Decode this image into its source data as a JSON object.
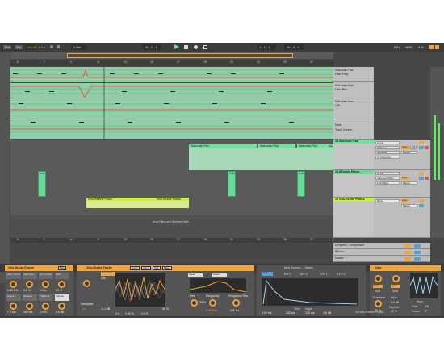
{
  "transport": {
    "link": "Link",
    "tap": "Tap",
    "tempo": "120.00",
    "signature": "4 / 4",
    "quantize": "1 Bar",
    "position": "13 . 1 . 1",
    "loop_start": "1 . 1 . 1",
    "loop_length": "16 . 0 . 0",
    "key": "KEY",
    "midi": "MIDI",
    "cpu": "6 %"
  },
  "tracks": [
    {
      "name": "Sidechain Pad",
      "sub": "Filter Freq"
    },
    {
      "name": "Sidechain Pad",
      "sub": "Filter Res"
    },
    {
      "name": "Sidechain Pad",
      "sub": "1 Rt"
    },
    {
      "name": "Mixer",
      "sub": "Track Volume"
    },
    {
      "name": "14 Sidechain Pad",
      "input": "All Ins",
      "routing": "3-Stimps",
      "monitor": "Sidechain",
      "channel": "All Channels",
      "mon_auto": "Auto",
      "mon_off": "Off",
      "master": "Master"
    },
    {
      "name": "15 A Humid Pillow",
      "input": "All Ins",
      "routing": "A-Humid Pillow",
      "monitor": "Filter Bass",
      "channel": "All Channels",
      "mon_auto": "Auto",
      "master": "Master"
    },
    {
      "name": "16 Velo-Resize Plucks",
      "input": "None",
      "monitor": "Auto",
      "master": "Master"
    }
  ],
  "clips": {
    "sidechain_a": "Sidechain Pad",
    "sidechain_b": "Sidechain Pad",
    "sidechain_c": "Sidechain Pad",
    "sidechain_d": "Sidechain",
    "humid": "A Hu",
    "plucks_a": "Velo-Resize Plucks",
    "plucks_b": "Velo-Resize Plucks"
  },
  "drop_hint": "Drop Files and Devices Here",
  "returns": [
    {
      "name": "A Reverb | Compressor"
    },
    {
      "name": "B Echo"
    },
    {
      "name": "Master"
    }
  ],
  "devices": {
    "rack_title": "Velo-Resize Plucks",
    "rack_buttons": [
      "Filter Cutoff",
      "Filter Res",
      "Osc 2 Pitch",
      "Echo",
      "Attack",
      "Release",
      "Transient",
      "Volume"
    ],
    "rack_values": [
      "5.88 kHz",
      "0.0 %",
      "0.0 st",
      "21 %",
      "7.5 ms",
      "180 ms",
      "0.0 %",
      "0.0 dB"
    ],
    "map": "Map",
    "wavetable_title": "Velo-Resize Plucks",
    "osc1": "Osc 1",
    "osc2": "Osc 2",
    "sub": "Sub",
    "filter": "Filter",
    "distortion": "Distortion",
    "distortion_value": "23k",
    "wt_readout": [
      "-0.1 dB",
      "0 S",
      "1.00 %",
      "0.0 S"
    ],
    "wt_percent": "50 %",
    "transpose": "Transpose",
    "transpose_value": "0.0",
    "env_lp": "Clean",
    "freq": "Frequency",
    "freq_value": "5.86 kHz",
    "res": "Res",
    "res_value": "35 %",
    "freq2": "Frequency Res",
    "freq2_value": "460 Hz",
    "amp_tab": "Amp",
    "env_tabs": [
      "Mod Sources",
      "Env 2",
      "Env 3",
      "LFO 1",
      "LFO 2"
    ],
    "matrix": "Matrix",
    "time": "Time",
    "slope": "Slope",
    "env_values": [
      "0.00 ms",
      "142 ms",
      "100 ms",
      "1.0 dB"
    ],
    "echo_title": "Echo",
    "echo_values": [
      "Sync",
      "Sync",
      "1/16",
      "1/16"
    ],
    "echo_feedback": "Feedback",
    "echo_fb_value": "40 %",
    "echo_input": "Input",
    "echo_gain": "0.0 dB",
    "echo_dry": "Dry/Wet",
    "echo_dry_value": "21 %",
    "echo_ch": "Ch",
    "echo_sync": "Sync",
    "echo_rate": "Rate",
    "echo_rate_value": "1/4",
    "echo_phase": "Phase",
    "echo_phase_value": "0°"
  },
  "status_bar": {
    "track": "16-Velo-Resize Plucks"
  },
  "ruler_marks": [
    "5",
    "7",
    "9",
    "11",
    "13",
    "15",
    "17",
    "19",
    "21",
    "23",
    "25",
    "27"
  ],
  "colors": {
    "accent": "#f2a33a",
    "clip_green": "#6ee3a0",
    "lane_green": "#8fcfa7",
    "lime": "#c7f03c"
  }
}
